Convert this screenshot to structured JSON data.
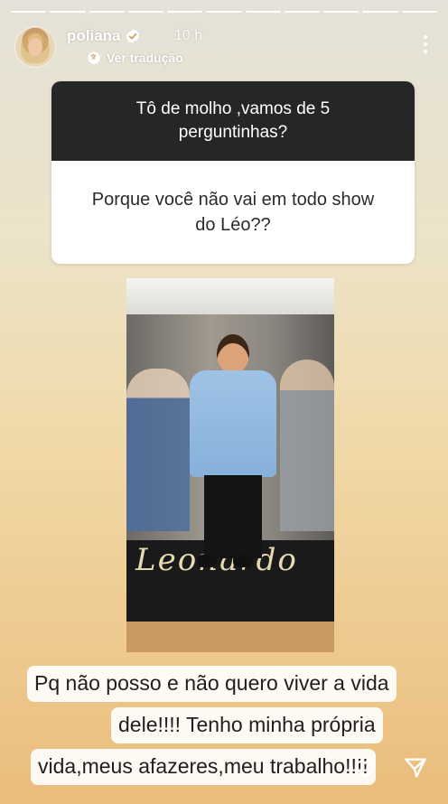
{
  "story": {
    "progress_segments": 11,
    "user": {
      "username": "poliana",
      "time_ago": "10 h",
      "translate_label": "Ver tradução"
    },
    "question": {
      "prompt": "Tô de molho ,vamos de 5 perguntinhas?",
      "text": "Porque você não vai em todo show do Léo??"
    },
    "photo": {
      "icon": "photo",
      "logo_text": "Leonardo"
    },
    "answer": {
      "line1": "Pq não posso  e não quero viver a vida",
      "line2": "dele!!!! Tenho minha própria",
      "line3": "vida,meus afazeres,meu trabalho!!!!"
    }
  },
  "icons": {
    "verified": "verified-badge-icon",
    "more": "more-vertical-icon",
    "translate": "translate-icon",
    "like": "heart-icon",
    "share": "send-icon"
  },
  "colors": {
    "question_header": "#262626",
    "question_body": "#ffffff",
    "verified": "#ffffff"
  }
}
